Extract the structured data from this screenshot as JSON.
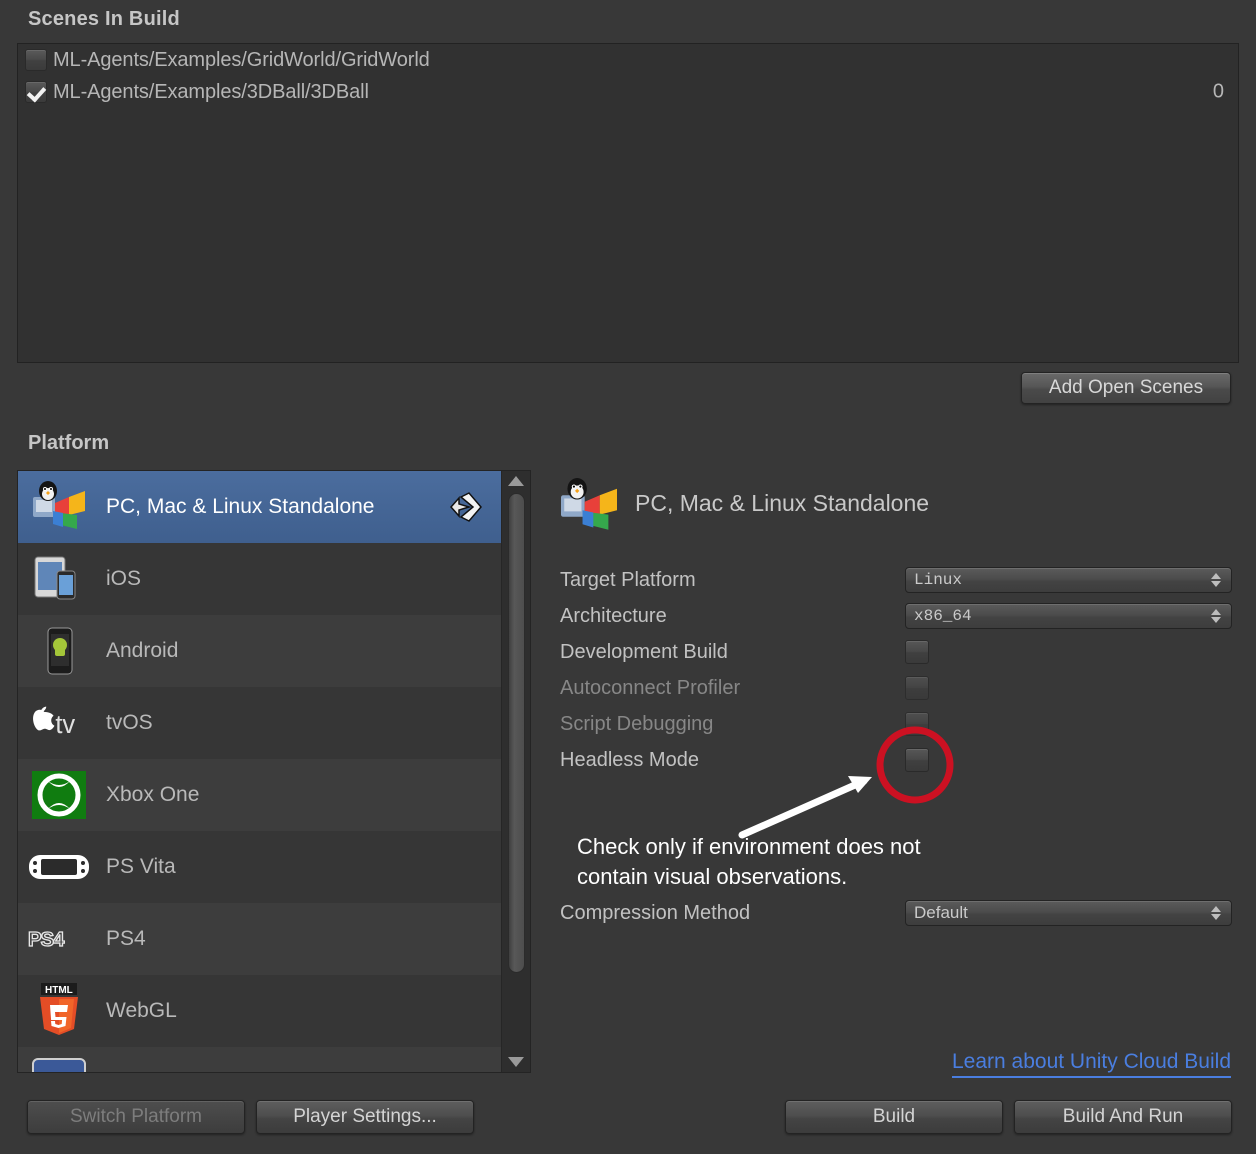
{
  "scenes_section": {
    "header": "Scenes In Build",
    "rows": [
      {
        "label": "ML-Agents/Examples/GridWorld/GridWorld",
        "checked": false,
        "index": ""
      },
      {
        "label": "ML-Agents/Examples/3DBall/3DBall",
        "checked": true,
        "index": "0"
      }
    ],
    "add_open_scenes_label": "Add Open Scenes"
  },
  "platform_section": {
    "header": "Platform",
    "items": [
      {
        "label": "PC, Mac & Linux Standalone",
        "icon": "linux-windows-mac-icon",
        "selected": true
      },
      {
        "label": "iOS",
        "icon": "ios-devices-icon",
        "selected": false
      },
      {
        "label": "Android",
        "icon": "android-phone-icon",
        "selected": false
      },
      {
        "label": "tvOS",
        "icon": "apple-tv-icon",
        "selected": false
      },
      {
        "label": "Xbox One",
        "icon": "xbox-icon",
        "selected": false
      },
      {
        "label": "PS Vita",
        "icon": "ps-vita-icon",
        "selected": false
      },
      {
        "label": "PS4",
        "icon": "ps4-icon",
        "selected": false
      },
      {
        "label": "WebGL",
        "icon": "html5-icon",
        "selected": false
      },
      {
        "label": "",
        "icon": "facebook-icon",
        "selected": false
      }
    ],
    "selected_marker_icon": "unity-logo-icon",
    "switch_platform_label": "Switch Platform",
    "switch_platform_disabled": true,
    "player_settings_label": "Player Settings..."
  },
  "settings_pane": {
    "title": "PC, Mac & Linux Standalone",
    "title_icon": "linux-windows-mac-icon",
    "fields": [
      {
        "label": "Target Platform",
        "type": "dropdown",
        "value": "Linux",
        "mono": true,
        "dim": false
      },
      {
        "label": "Architecture",
        "type": "dropdown",
        "value": "x86_64",
        "mono": true,
        "dim": false
      },
      {
        "label": "Development Build",
        "type": "checkbox",
        "checked": false,
        "dim": false
      },
      {
        "label": "Autoconnect Profiler",
        "type": "checkbox",
        "checked": false,
        "dim": true
      },
      {
        "label": "Script Debugging",
        "type": "checkbox",
        "checked": false,
        "dim": true
      },
      {
        "label": "Headless Mode",
        "type": "checkbox",
        "checked": false,
        "dim": false
      },
      {
        "label": "Compression Method",
        "type": "dropdown",
        "value": "Default",
        "mono": false,
        "dim": false
      }
    ],
    "annotation": {
      "line1": "Check only if environment does not",
      "line2": "contain visual observations.",
      "highlight_color": "#cc1122",
      "arrow_color": "#ffffff"
    },
    "cloud_build_link": "Learn about Unity Cloud Build",
    "build_label": "Build",
    "build_and_run_label": "Build And Run"
  }
}
